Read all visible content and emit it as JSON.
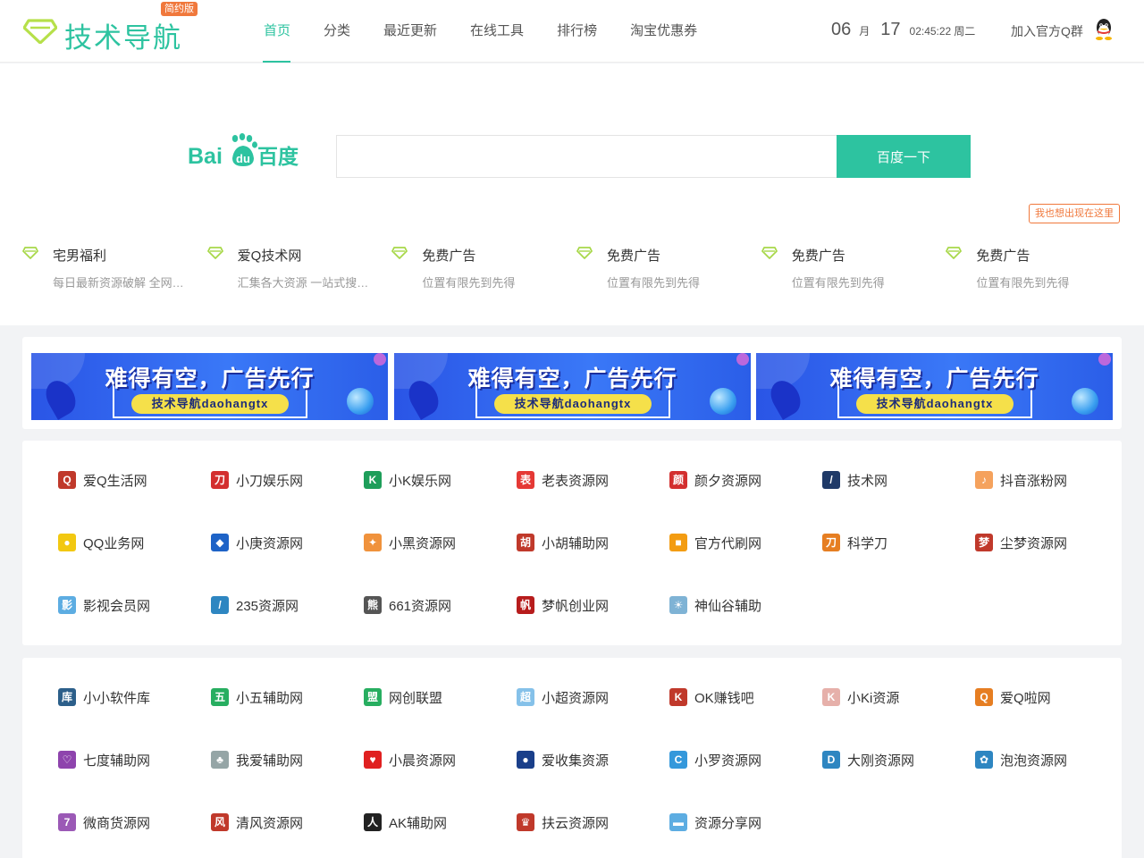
{
  "header": {
    "logo_text": "技术导航",
    "logo_badge": "简约版",
    "nav": [
      "首页",
      "分类",
      "最近更新",
      "在线工具",
      "排行榜",
      "淘宝优惠券"
    ],
    "clock": {
      "month": "06",
      "month_unit": "月",
      "day": "17",
      "time": "02:45:22",
      "weekday": "周二"
    },
    "qq_join": "加入官方Q群"
  },
  "search": {
    "engine_logo_text_left": "Bai",
    "engine_logo_text_du": "du",
    "engine_logo_text_right": "百度",
    "placeholder": "",
    "button": "百度一下"
  },
  "ad_tag": "我也想出现在这里",
  "featured": [
    {
      "title": "宅男福利",
      "desc": "每日最新资源破解 全网第一个宅男福利论坛"
    },
    {
      "title": "爱Q技术网",
      "desc": "汇集各大资源 一站式搜索下载平台"
    },
    {
      "title": "免费广告",
      "desc": "位置有限先到先得"
    },
    {
      "title": "免费广告",
      "desc": "位置有限先到先得"
    },
    {
      "title": "免费广告",
      "desc": "位置有限先到先得"
    },
    {
      "title": "免费广告",
      "desc": "位置有限先到先得"
    }
  ],
  "banners": [
    {
      "title": "难得有空，广告先行",
      "sub": "技术导航daohangtx"
    },
    {
      "title": "难得有空，广告先行",
      "sub": "技术导航daohangtx"
    },
    {
      "title": "难得有空，广告先行",
      "sub": "技术导航daohangtx"
    }
  ],
  "colors": {
    "accent": "#2dc3a0",
    "orange": "#f0783c",
    "banner_blue": "#3a78f7"
  },
  "link_groups": [
    [
      {
        "name": "爱Q生活网",
        "icon": "qq-penguin-icon",
        "glyph": "Q",
        "color": "#c0392b"
      },
      {
        "name": "小刀娱乐网",
        "icon": "xiaodao-icon",
        "glyph": "刀",
        "color": "#d32f2f"
      },
      {
        "name": "小K娱乐网",
        "icon": "k-letter-icon",
        "glyph": "K",
        "color": "#1e9e5a"
      },
      {
        "name": "老表资源网",
        "icon": "laobiao-icon",
        "glyph": "表",
        "color": "#e53935"
      },
      {
        "name": "颜夕资源网",
        "icon": "yan-icon",
        "glyph": "颜",
        "color": "#d32f2f"
      },
      {
        "name": "技术网",
        "icon": "stripes-icon",
        "glyph": "/",
        "color": "#1f3a68"
      },
      {
        "name": "抖音涨粉网",
        "icon": "douyin-icon",
        "glyph": "♪",
        "color": "#f5a25d"
      },
      {
        "name": "QQ业务网",
        "icon": "qq-yellow-icon",
        "glyph": "●",
        "color": "#f2c811"
      },
      {
        "name": "小庚资源网",
        "icon": "cube-icon",
        "glyph": "◆",
        "color": "#1e63c7"
      },
      {
        "name": "小黑资源网",
        "icon": "badge-icon",
        "glyph": "✦",
        "color": "#f0923c"
      },
      {
        "name": "小胡辅助网",
        "icon": "penguin-icon",
        "glyph": "胡",
        "color": "#c0392b"
      },
      {
        "name": "官方代刷网",
        "icon": "shop-icon",
        "glyph": "■",
        "color": "#f39c12"
      },
      {
        "name": "科学刀",
        "icon": "knife-icon",
        "glyph": "刀",
        "color": "#e67e22"
      },
      {
        "name": "尘梦资源网",
        "icon": "chenmeng-icon",
        "glyph": "梦",
        "color": "#c0392b"
      },
      {
        "name": "影视会员网",
        "icon": "film-icon",
        "glyph": "影",
        "color": "#5dade2"
      },
      {
        "name": "235资源网",
        "icon": "stripe-blue-icon",
        "glyph": "/",
        "color": "#2e86c1"
      },
      {
        "name": "661资源网",
        "icon": "panda-icon",
        "glyph": "熊",
        "color": "#555555"
      },
      {
        "name": "梦帆创业网",
        "icon": "mengfan-icon",
        "glyph": "帆",
        "color": "#b71c1c"
      },
      {
        "name": "神仙谷辅助",
        "icon": "sun-icon",
        "glyph": "☀",
        "color": "#7fb3d5"
      }
    ],
    [
      {
        "name": "小小软件库",
        "icon": "book-icon",
        "glyph": "库",
        "color": "#2c5f8a"
      },
      {
        "name": "小五辅助网",
        "icon": "wu-icon",
        "glyph": "五",
        "color": "#27ae60"
      },
      {
        "name": "网创联盟",
        "icon": "meng-icon",
        "glyph": "盟",
        "color": "#27ae60"
      },
      {
        "name": "小超资源网",
        "icon": "chao-icon",
        "glyph": "超",
        "color": "#85c1e9"
      },
      {
        "name": "OK赚钱吧",
        "icon": "ok-icon",
        "glyph": "K",
        "color": "#c0392b"
      },
      {
        "name": "小Ki资源",
        "icon": "ki-icon",
        "glyph": "K",
        "color": "#e6b0aa"
      },
      {
        "name": "爱Q啦网",
        "icon": "q-circle-icon",
        "glyph": "Q",
        "color": "#e67e22"
      },
      {
        "name": "七度辅助网",
        "icon": "heart-outline-icon",
        "glyph": "♡",
        "color": "#8e44ad"
      },
      {
        "name": "我爱辅助网",
        "icon": "tree-icon",
        "glyph": "♣",
        "color": "#95a5a6"
      },
      {
        "name": "小晨资源网",
        "icon": "heart-icon",
        "glyph": "♥",
        "color": "#e02020"
      },
      {
        "name": "爱收集资源",
        "icon": "ball-icon",
        "glyph": "●",
        "color": "#1a3f8a"
      },
      {
        "name": "小罗资源网",
        "icon": "c-letter-icon",
        "glyph": "C",
        "color": "#3498db"
      },
      {
        "name": "大刚资源网",
        "icon": "d-letter-icon",
        "glyph": "D",
        "color": "#2e86c1"
      },
      {
        "name": "泡泡资源网",
        "icon": "bubble-icon",
        "glyph": "✿",
        "color": "#2e86c1"
      },
      {
        "name": "微商货源网",
        "icon": "seven-icon",
        "glyph": "7",
        "color": "#9b59b6"
      },
      {
        "name": "清风资源网",
        "icon": "seal-icon",
        "glyph": "风",
        "color": "#c0392b"
      },
      {
        "name": "AK辅助网",
        "icon": "person-icon",
        "glyph": "人",
        "color": "#222222"
      },
      {
        "name": "扶云资源网",
        "icon": "crown-icon",
        "glyph": "♛",
        "color": "#c0392b"
      },
      {
        "name": "资源分享网",
        "icon": "photo-icon",
        "glyph": "▬",
        "color": "#5dade2"
      }
    ]
  ]
}
